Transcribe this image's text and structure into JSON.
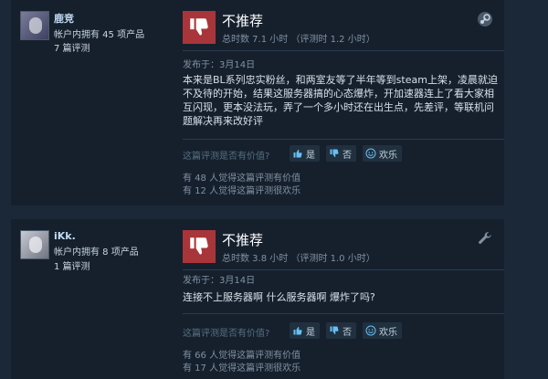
{
  "reviews": [
    {
      "username": "鹿竞",
      "products_owned": "帐户内拥有 45 项产品",
      "review_count": "7 篇评测",
      "verdict": "不推荐",
      "hours": "总时数 7.1 小时 （评测时 1.2 小时）",
      "corner_icon": "steam-icon",
      "posted": "发布于：3月14日",
      "text": "本来是BL系列忠实粉丝，和两室友等了半年等到steam上架，凌晨就迫不及待的开始，结果这服务器搞的心态爆炸，开加速器连上了看大家相互闪现，更本没法玩，弄了一个多小时还在出生点，先差评，等联机问题解决再来改好评",
      "helpful_question": "这篇评测是否有价值?",
      "yes_label": "是",
      "no_label": "否",
      "funny_label": "欢乐",
      "helpful_count": "有 48 人觉得这篇评测有价值",
      "funny_count": "有 12 人觉得这篇评测很欢乐"
    },
    {
      "username": "iKk.",
      "products_owned": "帐户内拥有 8 项产品",
      "review_count": "1 篇评测",
      "verdict": "不推荐",
      "hours": "总时数 3.8 小时 （评测时 1.0 小时）",
      "corner_icon": "wrench-icon",
      "posted": "发布于：3月14日",
      "text": "连接不上服务器啊 什么服务器啊 爆炸了吗?",
      "helpful_question": "这篇评测是否有价值?",
      "yes_label": "是",
      "no_label": "否",
      "funny_label": "欢乐",
      "helpful_count": "有 66 人觉得这篇评测有价值",
      "funny_count": "有 17 人觉得这篇评测很欢乐"
    }
  ],
  "colors": {
    "background": "#1b2838",
    "card": "#16202d",
    "thumb_down": "#a8353a",
    "username": "#c1dbf4"
  }
}
